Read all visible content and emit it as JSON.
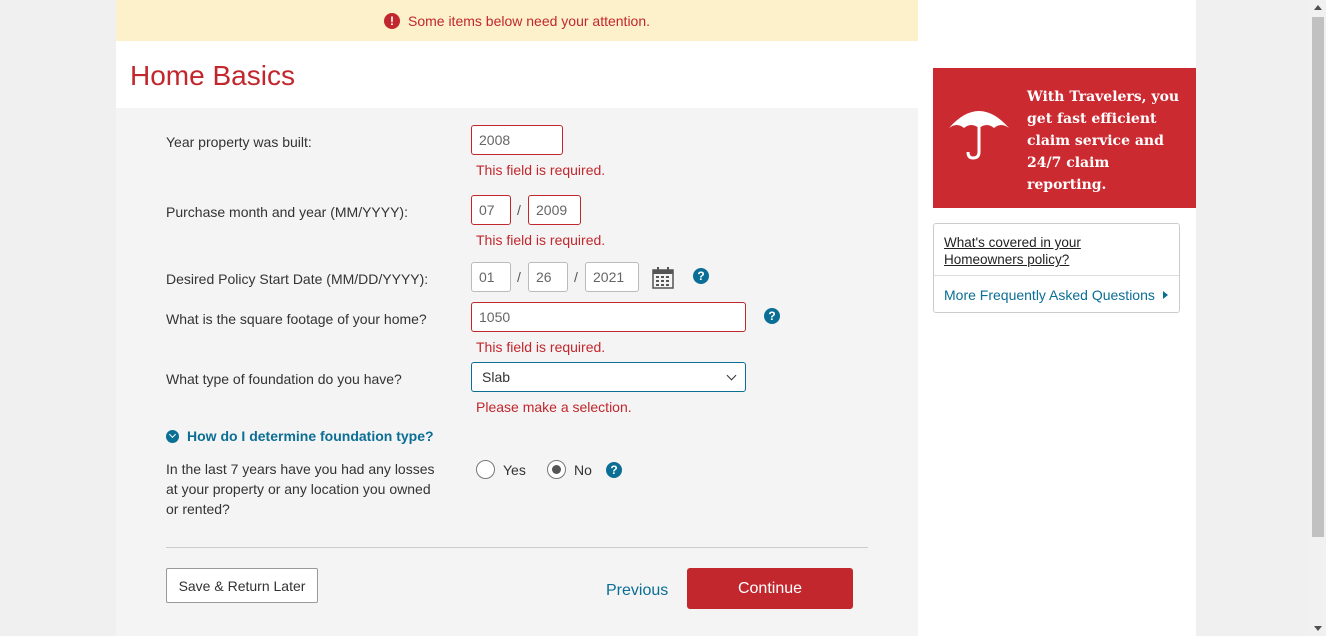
{
  "alert": {
    "text": "Some items below need your attention.",
    "icon": "alert-icon",
    "icon_glyph": "!"
  },
  "page_title": "Home Basics",
  "fields": {
    "year_built": {
      "label": "Year property was built:",
      "value": "2008",
      "error": "This field is required."
    },
    "purchase": {
      "label": "Purchase month and year (MM/YYYY):",
      "month": "07",
      "year": "2009",
      "separator": "/",
      "error": "This field is required."
    },
    "start_date": {
      "label": "Desired Policy Start Date (MM/DD/YYYY):",
      "month": "01",
      "day": "26",
      "year": "2021",
      "separator": "/"
    },
    "square_footage": {
      "label": "What is the square footage of your home?",
      "value": "1050",
      "error": "This field is required."
    },
    "foundation": {
      "label": "What type of foundation do you have?",
      "selected": "Slab",
      "error": "Please make a selection."
    },
    "foundation_help": "How do I determine foundation type?",
    "losses": {
      "label_lines": [
        "In the last 7 years have you had any losses",
        "at your property or any location you owned",
        "or rented?"
      ],
      "options": [
        "Yes",
        "No"
      ],
      "selected": "No"
    }
  },
  "help_glyph": "?",
  "buttons": {
    "save": "Save & Return Later",
    "previous": "Previous",
    "continue": "Continue"
  },
  "promo": {
    "text": "With Travelers, you get fast efficient claim service and 24/7 claim reporting."
  },
  "faq": {
    "covered_link": "What's covered in your Homeowners policy?",
    "more_link": "More Frequently Asked Questions"
  },
  "colors": {
    "brand_red": "#c1272d",
    "link_blue": "#0b6e95",
    "alert_bg": "#fdf1cc"
  }
}
